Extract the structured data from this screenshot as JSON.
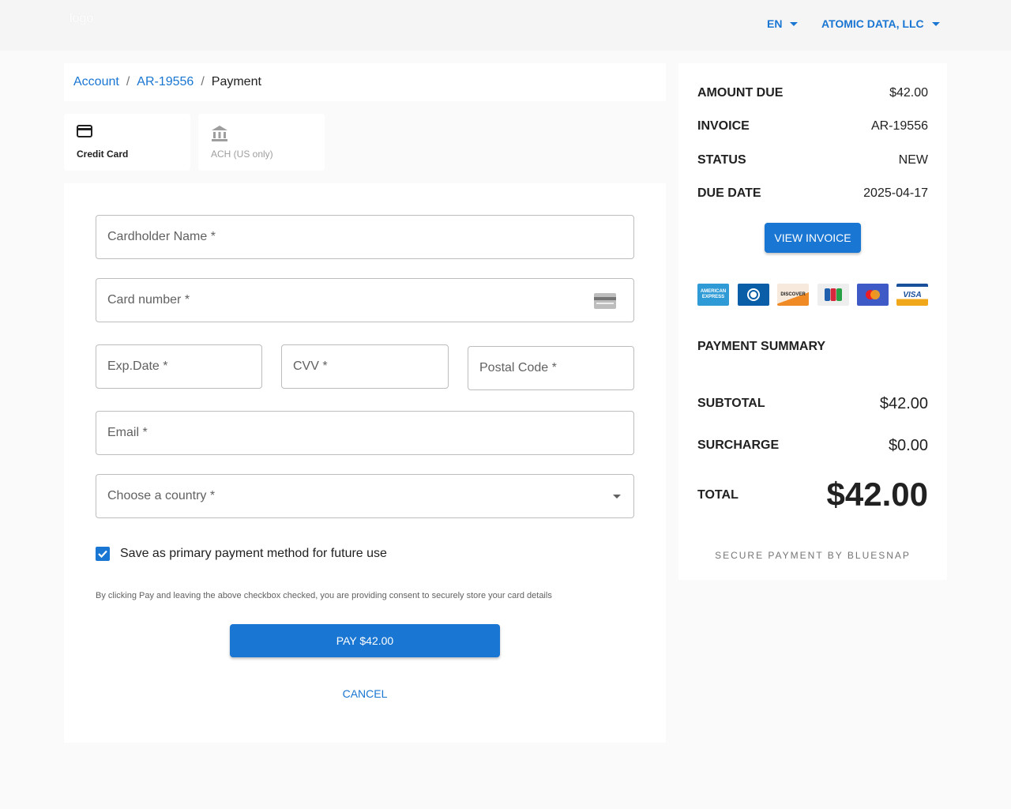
{
  "header": {
    "logo_text": "logo",
    "language": "EN",
    "account_name": "ATOMIC DATA, LLC"
  },
  "breadcrumb": {
    "items": [
      "Account",
      "AR-19556"
    ],
    "current": "Payment"
  },
  "payment_tabs": [
    {
      "label": "Credit Card",
      "icon": "credit-card-icon",
      "active": true
    },
    {
      "label": "ACH (US only)",
      "icon": "bank-icon",
      "active": false
    }
  ],
  "form": {
    "cardholder_label": "Cardholder Name *",
    "card_number_label": "Card number *",
    "exp_label": "Exp.Date *",
    "cvv_label": "CVV *",
    "postal_label": "Postal Code *",
    "email_label": "Email *",
    "country_label": "Choose a country *",
    "save_label": "Save as primary payment method for future use",
    "save_checked": true,
    "consent_text": "By clicking Pay and leaving the above checkbox checked, you are providing consent to securely store your card details",
    "pay_label": "PAY $42.00",
    "cancel_label": "CANCEL"
  },
  "invoice": {
    "amount_due_label": "AMOUNT DUE",
    "amount_due": "$42.00",
    "invoice_label": "INVOICE",
    "invoice_number": "AR-19556",
    "status_label": "STATUS",
    "status": "NEW",
    "due_date_label": "DUE DATE",
    "due_date": "2025-04-17",
    "view_label": "VIEW INVOICE"
  },
  "card_brands": [
    {
      "name": "amex",
      "text": "AMERICAN EXPRESS",
      "color": "#2e9bd6"
    },
    {
      "name": "diners",
      "text": "D",
      "color": "#0a5ea8"
    },
    {
      "name": "discover",
      "text": "DISCOVER",
      "color": "#f7e9dc"
    },
    {
      "name": "jcb",
      "text": "JCB",
      "color": "#eeeeee"
    },
    {
      "name": "mastercard",
      "text": "",
      "color": "#3e5ac6"
    },
    {
      "name": "visa",
      "text": "VISA",
      "color": "#1a4f9c"
    }
  ],
  "summary": {
    "title": "PAYMENT SUMMARY",
    "subtotal_label": "SUBTOTAL",
    "subtotal": "$42.00",
    "surcharge_label": "SURCHARGE",
    "surcharge": "$0.00",
    "total_label": "TOTAL",
    "total": "$42.00",
    "secure_text": "SECURE PAYMENT BY BLUESNAP"
  },
  "colors": {
    "accent": "#1976d2",
    "background": "#fafafa"
  }
}
